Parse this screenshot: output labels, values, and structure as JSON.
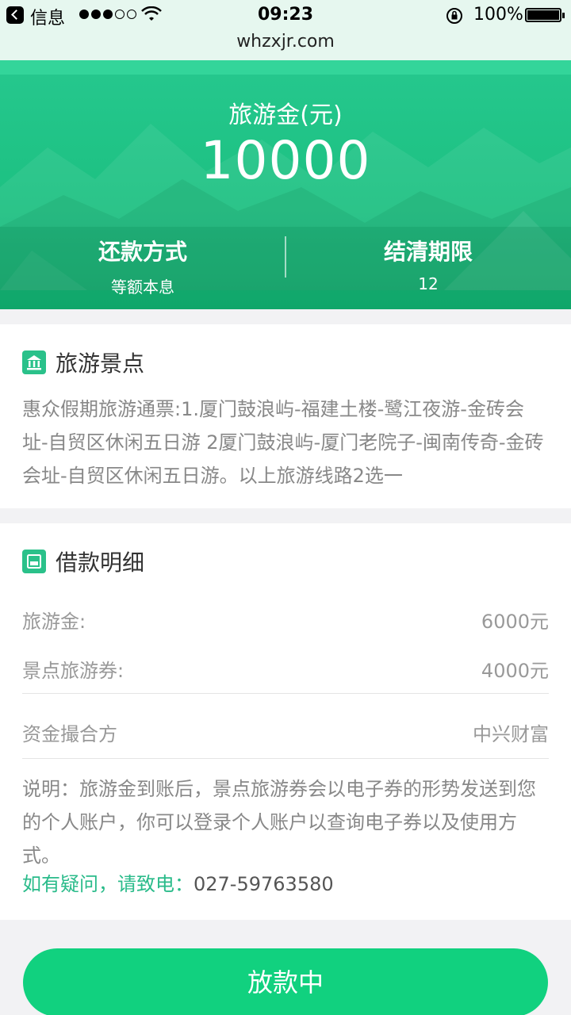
{
  "status_bar": {
    "back_label": "信息",
    "time": "09:23",
    "battery": "100%"
  },
  "browser": {
    "url": "whzxjr.com"
  },
  "hero": {
    "title": "旅游金(元)",
    "amount": "10000",
    "repay_label": "还款方式",
    "repay_value": "等额本息",
    "term_label": "结清期限",
    "term_value": "12"
  },
  "attractions": {
    "title": "旅游景点",
    "description": "惠众假期旅游通票:1.厦门鼓浪屿-福建土楼-鹭江夜游-金砖会址-自贸区休闲五日游 2厦门鼓浪屿-厦门老院子-闽南传奇-金砖会址-自贸区休闲五日游。以上旅游线路2选一"
  },
  "loan_detail": {
    "title": "借款明细",
    "rows": [
      {
        "label": "旅游金:",
        "value": "6000元"
      },
      {
        "label": "景点旅游券:",
        "value": "4000元"
      },
      {
        "label": "资金撮合方",
        "value": "中兴财富"
      }
    ],
    "note": "说明：旅游金到账后，景点旅游券会以电子券的形势发送到您的个人账户，你可以登录个人账户以查询电子券以及使用方式。",
    "contact_prompt": "如有疑问，请致电：",
    "contact_phone": "027-59763580"
  },
  "action_button": "放款中",
  "colors": {
    "brand_green": "#1cc081",
    "button_green": "#11d17f",
    "accent_text": "#2abb8a"
  }
}
